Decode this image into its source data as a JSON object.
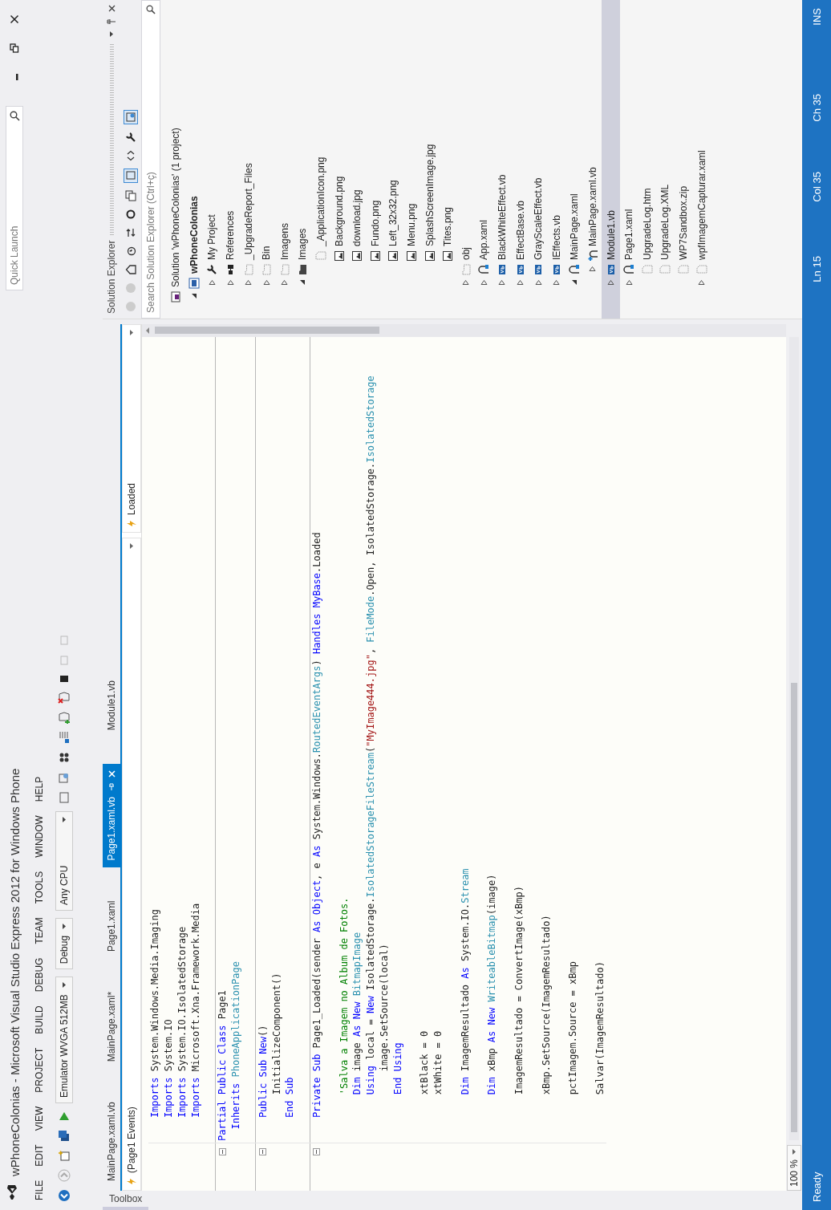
{
  "window": {
    "title": "wPhoneColonias - Microsoft Visual Studio Express 2012 for Windows Phone",
    "quick_launch": {
      "placeholder": "Quick Launch"
    }
  },
  "menu": [
    "FILE",
    "EDIT",
    "VIEW",
    "PROJECT",
    "BUILD",
    "DEBUG",
    "TEAM",
    "TOOLS",
    "WINDOW",
    "HELP"
  ],
  "toolbar": {
    "target": "Emulator WVGA 512MB",
    "configuration": "Debug",
    "platform": "Any CPU"
  },
  "toolbox_tab": "Toolbox",
  "document_tabs": [
    {
      "label": "MainPage.xaml.vb",
      "selected": false
    },
    {
      "label": "MainPage.xaml*",
      "selected": false
    },
    {
      "label": "Page1.xaml",
      "selected": false
    },
    {
      "label": "Page1.xaml.vb",
      "selected": true
    },
    {
      "label": "Module1.vb",
      "selected": false
    }
  ],
  "editor": {
    "type_dropdown": "(Page1 Events)",
    "member_dropdown": "Loaded",
    "zoom": "100 %",
    "lines": [
      {
        "fold": false,
        "segments": [
          {
            "text": "    Imports",
            "kind": "keyword"
          },
          {
            "text": " System.Windows.Media.Imaging",
            "kind": "plain"
          }
        ]
      },
      {
        "fold": false,
        "segments": [
          {
            "text": "    Imports",
            "kind": "keyword"
          },
          {
            "text": " System.IO",
            "kind": "plain"
          }
        ]
      },
      {
        "fold": false,
        "segments": [
          {
            "text": "    Imports",
            "kind": "keyword"
          },
          {
            "text": " System.IO.IsolatedStorage",
            "kind": "plain"
          }
        ]
      },
      {
        "fold": false,
        "segments": [
          {
            "text": "    Imports",
            "kind": "keyword"
          },
          {
            "text": " Microsoft.Xna.Framework.Media",
            "kind": "plain"
          }
        ]
      },
      {
        "fold": false
      },
      {
        "fold": true,
        "segments": [
          {
            "text": "Partial Public Class",
            "kind": "keyword"
          },
          {
            "text": " Page1",
            "kind": "plain"
          }
        ]
      },
      {
        "fold": false,
        "segments": [
          {
            "text": "  Inherits ",
            "kind": "keyword"
          },
          {
            "text": "PhoneApplicationPage",
            "kind": "type"
          }
        ]
      },
      {
        "fold": false
      },
      {
        "fold": true,
        "segments": [
          {
            "text": "    Public Sub New",
            "kind": "keyword"
          },
          {
            "text": "()",
            "kind": "plain"
          }
        ]
      },
      {
        "fold": false,
        "segments": [
          {
            "text": "        InitializeComponent()",
            "kind": "plain"
          }
        ]
      },
      {
        "fold": false,
        "segments": [
          {
            "text": "    End Sub",
            "kind": "keyword"
          }
        ]
      },
      {
        "fold": false
      },
      {
        "fold": true,
        "segments": [
          {
            "text": "    Private Sub",
            "kind": "keyword"
          },
          {
            "text": " Page1_Loaded(sender ",
            "kind": "plain"
          },
          {
            "text": "As Object",
            "kind": "keyword"
          },
          {
            "text": ", e ",
            "kind": "plain"
          },
          {
            "text": "As",
            "kind": "keyword"
          },
          {
            "text": " System.Windows.",
            "kind": "plain"
          },
          {
            "text": "RoutedEventArgs",
            "kind": "type"
          },
          {
            "text": ") ",
            "kind": "plain"
          },
          {
            "text": "Handles MyBase",
            "kind": "keyword"
          },
          {
            "text": ".Loaded",
            "kind": "plain"
          }
        ]
      },
      {
        "fold": false
      },
      {
        "fold": false,
        "segments": [
          {
            "text": "        'Salva a Imagem no Album de Fotos.",
            "kind": "comment"
          }
        ]
      },
      {
        "fold": false,
        "segments": [
          {
            "text": "        Dim",
            "kind": "keyword"
          },
          {
            "text": " image ",
            "kind": "plain"
          },
          {
            "text": "As New ",
            "kind": "keyword"
          },
          {
            "text": "BitmapImage",
            "kind": "type"
          }
        ]
      },
      {
        "fold": false,
        "segments": [
          {
            "text": "        Using",
            "kind": "keyword"
          },
          {
            "text": " local = ",
            "kind": "plain"
          },
          {
            "text": "New ",
            "kind": "keyword"
          },
          {
            "text": "IsolatedStorage.",
            "kind": "plain"
          },
          {
            "text": "IsolatedStorageFileStream",
            "kind": "type"
          },
          {
            "text": "(",
            "kind": "plain"
          },
          {
            "text": "\"MyImage444.jpg\"",
            "kind": "string"
          },
          {
            "text": ", ",
            "kind": "plain"
          },
          {
            "text": "FileMode",
            "kind": "type"
          },
          {
            "text": ".Open, IsolatedStorage.",
            "kind": "plain"
          },
          {
            "text": "IsolatedStorage",
            "kind": "type"
          }
        ]
      },
      {
        "fold": false,
        "segments": [
          {
            "text": "            image.SetSource(local)",
            "kind": "plain"
          }
        ]
      },
      {
        "fold": false,
        "segments": [
          {
            "text": "        End Using",
            "kind": "keyword"
          }
        ]
      },
      {
        "fold": false
      },
      {
        "fold": false,
        "segments": [
          {
            "text": "        xtBlack = 0",
            "kind": "plain"
          }
        ]
      },
      {
        "fold": false,
        "segments": [
          {
            "text": "        xtWhite = 0",
            "kind": "plain"
          }
        ]
      },
      {
        "fold": false
      },
      {
        "fold": false,
        "segments": [
          {
            "text": "        Dim",
            "kind": "keyword"
          },
          {
            "text": " ImagemResultado ",
            "kind": "plain"
          },
          {
            "text": "As",
            "kind": "keyword"
          },
          {
            "text": " System.IO.",
            "kind": "plain"
          },
          {
            "text": "Stream",
            "kind": "type"
          }
        ]
      },
      {
        "fold": false
      },
      {
        "fold": false,
        "segments": [
          {
            "text": "        Dim",
            "kind": "keyword"
          },
          {
            "text": " xBmp ",
            "kind": "plain"
          },
          {
            "text": "As New ",
            "kind": "keyword"
          },
          {
            "text": "WriteableBitmap",
            "kind": "type"
          },
          {
            "text": "(image)",
            "kind": "plain"
          }
        ]
      },
      {
        "fold": false
      },
      {
        "fold": false,
        "segments": [
          {
            "text": "        ImagemResultado = ConvertImage(xBmp)",
            "kind": "plain"
          }
        ]
      },
      {
        "fold": false
      },
      {
        "fold": false,
        "segments": [
          {
            "text": "        xBmp.SetSource(ImagemResultado)",
            "kind": "plain"
          }
        ]
      },
      {
        "fold": false
      },
      {
        "fold": false,
        "segments": [
          {
            "text": "        pctImagem.Source = xBmp",
            "kind": "plain"
          }
        ]
      },
      {
        "fold": false
      },
      {
        "fold": false,
        "segments": [
          {
            "text": "        Salvar(ImagemResultado)",
            "kind": "plain"
          }
        ]
      }
    ]
  },
  "solution_explorer": {
    "title": "Solution Explorer",
    "search": {
      "placeholder": "Search Solution Explorer (Ctrl+ç)"
    },
    "tree": [
      {
        "label": "Solution 'wPhoneColonias' (1 project)",
        "kind": "solution",
        "selected": false,
        "children": [
          {
            "label": "wPhoneColonias",
            "kind": "project",
            "expanded": true,
            "selected": false,
            "children": [
              {
                "label": "My Project",
                "kind": "properties",
                "expanded": false,
                "selected": false
              },
              {
                "label": "References",
                "kind": "references",
                "expanded": false,
                "selected": false
              },
              {
                "label": "_UpgradeReport_Files",
                "kind": "excluded_folder",
                "expanded": false,
                "selected": false
              },
              {
                "label": "Bin",
                "kind": "excluded_folder",
                "expanded": false,
                "selected": false
              },
              {
                "label": "Imagens",
                "kind": "excluded_folder",
                "expanded": false,
                "selected": false
              },
              {
                "label": "Images",
                "kind": "folder",
                "expanded": true,
                "selected": false,
                "children": [
                  {
                    "label": "_ApplicationIcon.png",
                    "kind": "excluded_file",
                    "selected": false
                  },
                  {
                    "label": "Background.png",
                    "kind": "image",
                    "selected": false
                  },
                  {
                    "label": "download.jpg",
                    "kind": "image",
                    "selected": false
                  },
                  {
                    "label": "Fundo.png",
                    "kind": "image",
                    "selected": false
                  },
                  {
                    "label": "Left_32x32.png",
                    "kind": "image",
                    "selected": false
                  },
                  {
                    "label": "Menu.png",
                    "kind": "image",
                    "selected": false
                  },
                  {
                    "label": "SplashScreenImage.jpg",
                    "kind": "image",
                    "selected": false
                  },
                  {
                    "label": "Tites.png",
                    "kind": "image",
                    "selected": false
                  }
                ]
              },
              {
                "label": "obj",
                "kind": "excluded_folder",
                "expanded": false,
                "selected": false
              },
              {
                "label": "App.xaml",
                "kind": "xaml",
                "expanded": false,
                "selected": false
              },
              {
                "label": "BlackWhiteEffect.vb",
                "kind": "vb",
                "expanded": false,
                "selected": false
              },
              {
                "label": "EffectBase.vb",
                "kind": "vb",
                "expanded": false,
                "selected": false
              },
              {
                "label": "GrayScaleEffect.vb",
                "kind": "vb",
                "expanded": false,
                "selected": false
              },
              {
                "label": "IEffects.vb",
                "kind": "vb",
                "expanded": false,
                "selected": false
              },
              {
                "label": "MainPage.xaml",
                "kind": "xaml",
                "expanded": true,
                "selected": false,
                "children": [
                  {
                    "label": "MainPage.xaml.vb",
                    "kind": "codebehind",
                    "expanded": false,
                    "selected": false
                  }
                ]
              },
              {
                "label": "Module1.vb",
                "kind": "vb",
                "expanded": false,
                "selected": true
              },
              {
                "label": "Page1.xaml",
                "kind": "xaml",
                "expanded": false,
                "selected": false
              },
              {
                "label": "UpgradeLog.htm",
                "kind": "excluded_file",
                "selected": false
              },
              {
                "label": "UpgradeLog.XML",
                "kind": "excluded_file",
                "selected": false
              },
              {
                "label": "WP7Sandbox.zip",
                "kind": "excluded_file",
                "selected": false
              },
              {
                "label": "wpfImagemCapturar.xaml",
                "kind": "excluded_file",
                "expanded": false,
                "selected": false
              }
            ]
          }
        ]
      }
    ]
  },
  "status_bar": {
    "status": "Ready",
    "line": "Ln 15",
    "column": "Col 35",
    "char": "Ch 35",
    "mode": "INS"
  }
}
